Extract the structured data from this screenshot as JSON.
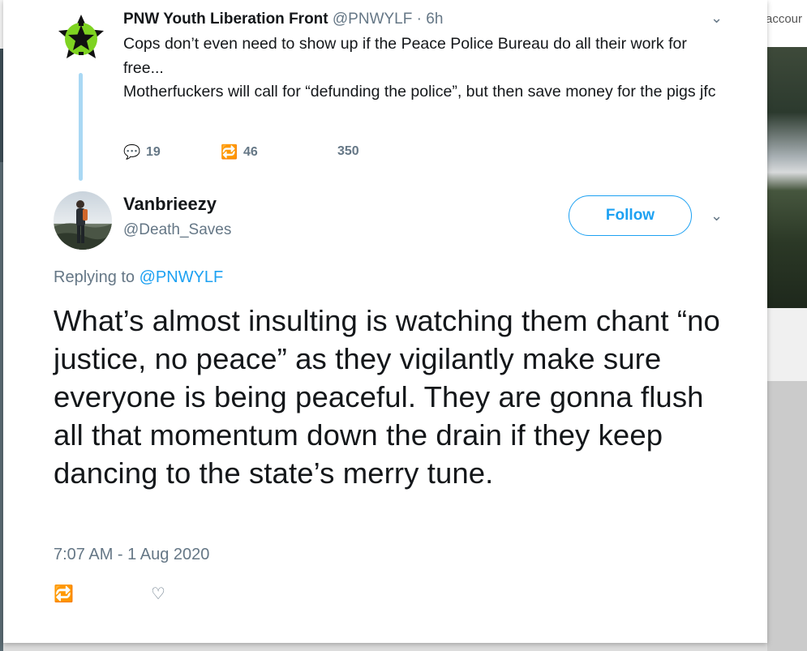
{
  "background": {
    "right_header_text": "accour"
  },
  "parent_tweet": {
    "avatar_icon": "green-star-logo-icon",
    "display_name": "PNW Youth Liberation Front",
    "handle": "@PNWYLF",
    "separator": "·",
    "time": "6h",
    "caret_glyph": "⌄",
    "text": "Cops don’t even need to show up if the Peace Police Bureau do all their work for free...\nMotherfuckers will call for “defunding the police”, but then save money for the pigs jfc",
    "reply_icon": "💬",
    "replies": "19",
    "retweet_icon": "🔁",
    "retweets": "46",
    "likes": "350"
  },
  "reply_tweet": {
    "display_name": "Vanbrieezy",
    "handle": "@Death_Saves",
    "follow_label": "Follow",
    "caret_glyph": "⌄",
    "replying_prefix": "Replying to",
    "replying_to": "@PNWYLF",
    "text": "What’s almost insulting is watching them chant “no justice, no peace” as they vigilantly make sure everyone is being peaceful. They are gonna flush all that momentum down the drain if they keep dancing to the state’s merry tune.",
    "timestamp": "7:07 AM - 1 Aug 2020",
    "action_icon_1": "🔁",
    "action_icon_2": "♡"
  },
  "colors": {
    "accent": "#1da1f2",
    "thread_line": "#a9d8f4",
    "muted_text": "#657786",
    "primary_text": "#14171a",
    "logo_green": "#7ed321"
  }
}
